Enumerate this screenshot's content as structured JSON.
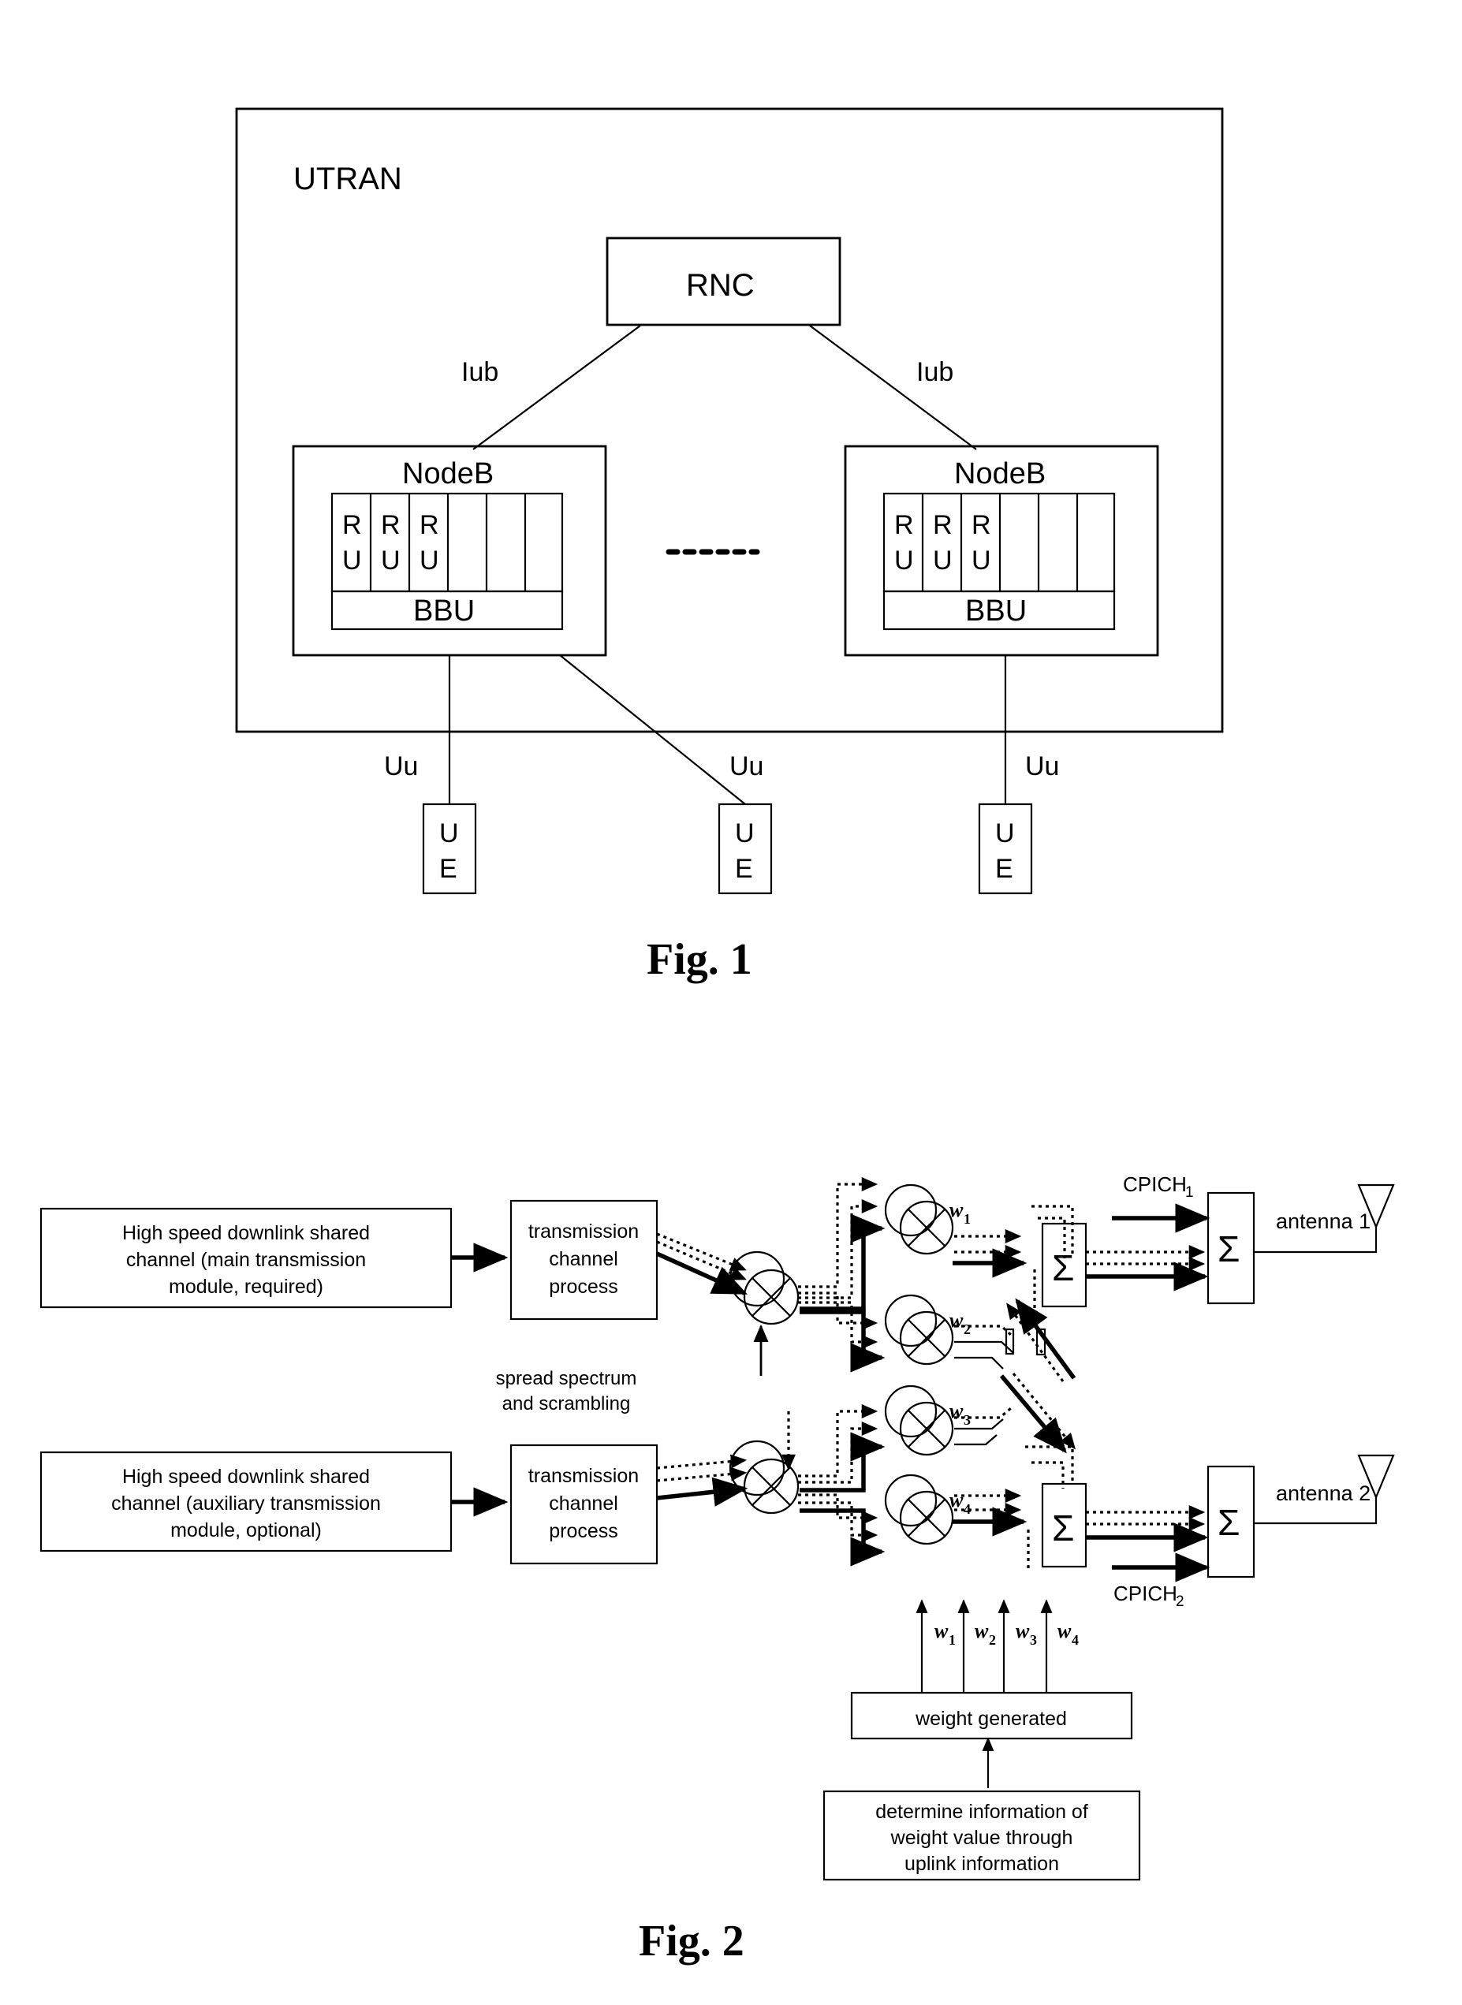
{
  "figure1": {
    "caption": "Fig. 1",
    "utran_label": "UTRAN",
    "rnc_label": "RNC",
    "iub_left_label": "Iub",
    "iub_right_label": "Iub",
    "ellipsis": "- - - - - - - -",
    "nodeb_left": {
      "title": "NodeB",
      "cells": [
        "R\nU",
        "R\nU",
        "R\nU",
        "",
        "",
        ""
      ],
      "cell_lines": [
        [
          "R",
          "U"
        ],
        [
          "R",
          "U"
        ],
        [
          "R",
          "U"
        ],
        [
          "",
          ""
        ],
        [
          "",
          ""
        ],
        [
          "",
          ""
        ]
      ],
      "bbu_label": "BBU"
    },
    "nodeb_right": {
      "title": "NodeB",
      "cell_lines": [
        [
          "R",
          "U"
        ],
        [
          "R",
          "U"
        ],
        [
          "R",
          "U"
        ],
        [
          "",
          ""
        ],
        [
          "",
          ""
        ],
        [
          "",
          ""
        ]
      ],
      "bbu_label": "BBU"
    },
    "uu_labels": [
      "Uu",
      "Uu",
      "Uu"
    ],
    "ue_boxes": [
      [
        "U",
        "E"
      ],
      [
        "U",
        "E"
      ],
      [
        "U",
        "E"
      ]
    ]
  },
  "figure2": {
    "caption": "Fig. 2",
    "main_channel_box": {
      "line1": "High speed downlink shared",
      "line2": "channel (main transmission",
      "line3": "module,  required)"
    },
    "aux_channel_box": {
      "line1": "High speed downlink shared",
      "line2": "channel (auxiliary transmission",
      "line3": "module,  optional)"
    },
    "tx_process_top": {
      "line1": "transmission",
      "line2": "channel",
      "line3": "process"
    },
    "tx_process_bottom": {
      "line1": "transmission",
      "line2": "channel",
      "line3": "process"
    },
    "spread_label": {
      "line1": "spread spectrum",
      "line2": "and scrambling"
    },
    "weights": [
      {
        "symbol": "w",
        "sub": "1"
      },
      {
        "symbol": "w",
        "sub": "2"
      },
      {
        "symbol": "w",
        "sub": "3"
      },
      {
        "symbol": "w",
        "sub": "4"
      }
    ],
    "weight_feed_labels": [
      {
        "symbol": "w",
        "sub": "1"
      },
      {
        "symbol": "w",
        "sub": "2"
      },
      {
        "symbol": "w",
        "sub": "3"
      },
      {
        "symbol": "w",
        "sub": "4"
      }
    ],
    "sum_symbol": "Σ",
    "cpich_top": {
      "text": "CPICH",
      "sub": "1"
    },
    "cpich_bottom": {
      "text": "CPICH",
      "sub": "2"
    },
    "antenna_top_label": "antenna 1",
    "antenna_bottom_label": "antenna 2",
    "weight_generated_label": "weight generated",
    "determine_box": {
      "line1": "determine information of",
      "line2": "weight value through",
      "line3": "uplink information"
    }
  },
  "colors": {
    "ink": "#000000",
    "paper": "#ffffff"
  }
}
